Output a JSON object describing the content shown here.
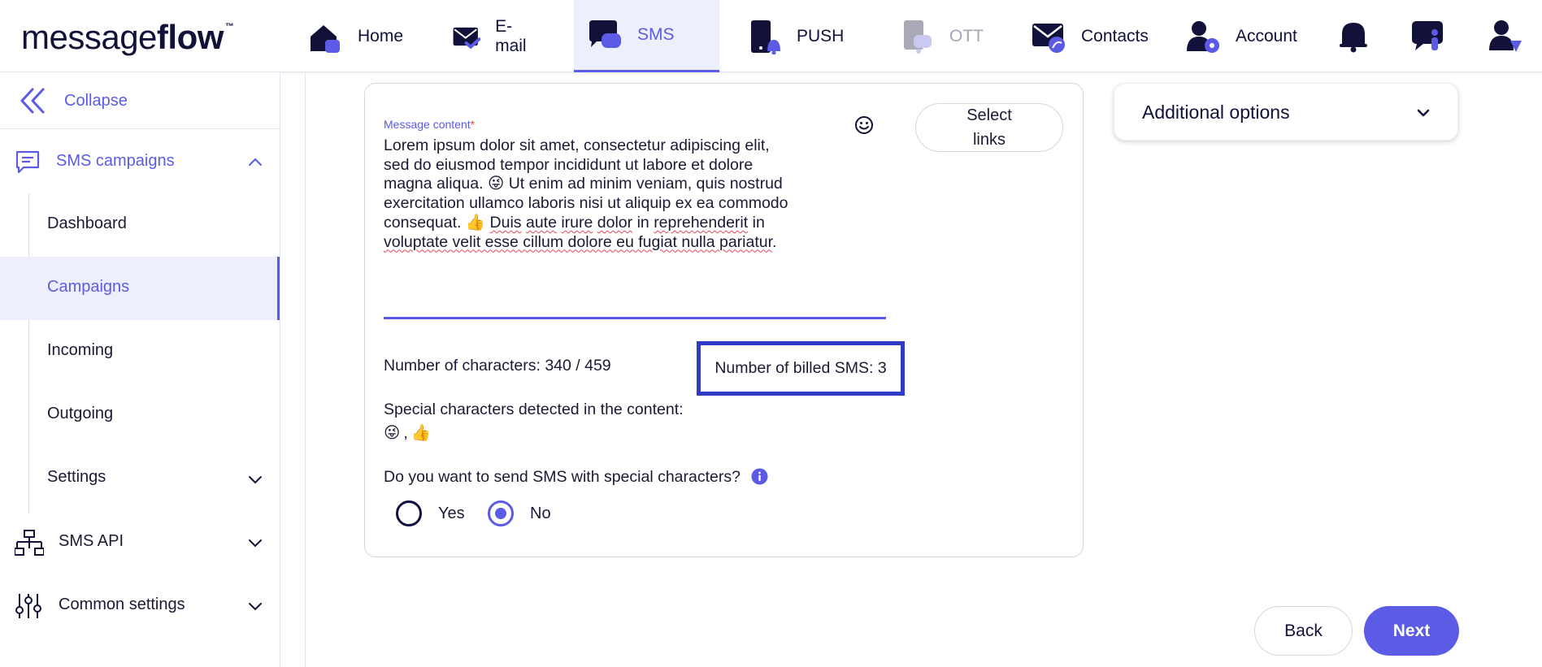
{
  "logo": {
    "part1": "message",
    "part2": "flow",
    "tm": "™"
  },
  "nav": {
    "items": [
      {
        "label": "Home",
        "icon": "home-icon"
      },
      {
        "label": "E-mail",
        "icon": "email-icon"
      },
      {
        "label": "SMS",
        "icon": "sms-icon",
        "active": true
      },
      {
        "label": "PUSH",
        "icon": "push-icon"
      },
      {
        "label": "OTT",
        "icon": "ott-icon",
        "disabled": true
      },
      {
        "label": "Contacts",
        "icon": "contacts-icon"
      },
      {
        "label": "Account",
        "icon": "account-icon"
      }
    ],
    "icons": [
      "bell-icon",
      "support-icon",
      "user-icon"
    ]
  },
  "sidebar": {
    "collapse_label": "Collapse",
    "sms_campaigns": "SMS campaigns",
    "sub_items": [
      "Dashboard",
      "Campaigns",
      "Incoming",
      "Outgoing",
      "Settings"
    ],
    "active_sub": "Campaigns",
    "sms_api": "SMS API",
    "common_settings": "Common settings"
  },
  "message": {
    "label": "Message content",
    "required_mark": "*",
    "line1": "Lorem ipsum dolor sit amet, consectetur adipiscing elit,",
    "line2": "sed do eiusmod tempor incididunt ut labore et dolore",
    "line3a": "magna aliqua.",
    "line3b": "Ut enim ad minim veniam, quis nostrud",
    "line4": "exercitation ullamco laboris nisi ut aliquip ex ea commodo",
    "line5a": "consequat.",
    "line5b_w1": "Duis",
    "line5b_w2": "aute",
    "line5b_w3": "irure",
    "line5b_w4": "dolor",
    "line5b_w5": "in",
    "line5b_w6": "reprehenderit",
    "line5b_w7": "in",
    "line6": "voluptate velit esse cillum dolore eu fugiat nulla pariatur",
    "line6_end": ".",
    "emoji1": "😜",
    "emoji2": "👍"
  },
  "select_links": {
    "line1": "Select",
    "line2": "links"
  },
  "counts": {
    "characters": "Number of characters: 340 / 459",
    "billed_sms": "Number of billed SMS: 3"
  },
  "special": {
    "label": "Special characters detected in the content:",
    "list_emoji1": "😜",
    "sep": ",",
    "list_emoji2": "👍"
  },
  "question": "Do you want to send SMS with special characters?",
  "radio": {
    "yes": "Yes",
    "no": "No",
    "selected": "No"
  },
  "additional_options": "Additional options",
  "buttons": {
    "back": "Back",
    "next": "Next"
  },
  "colors": {
    "accent": "#5b5be6",
    "highlight_box": "#2f3bc7",
    "dark": "#11113a"
  }
}
